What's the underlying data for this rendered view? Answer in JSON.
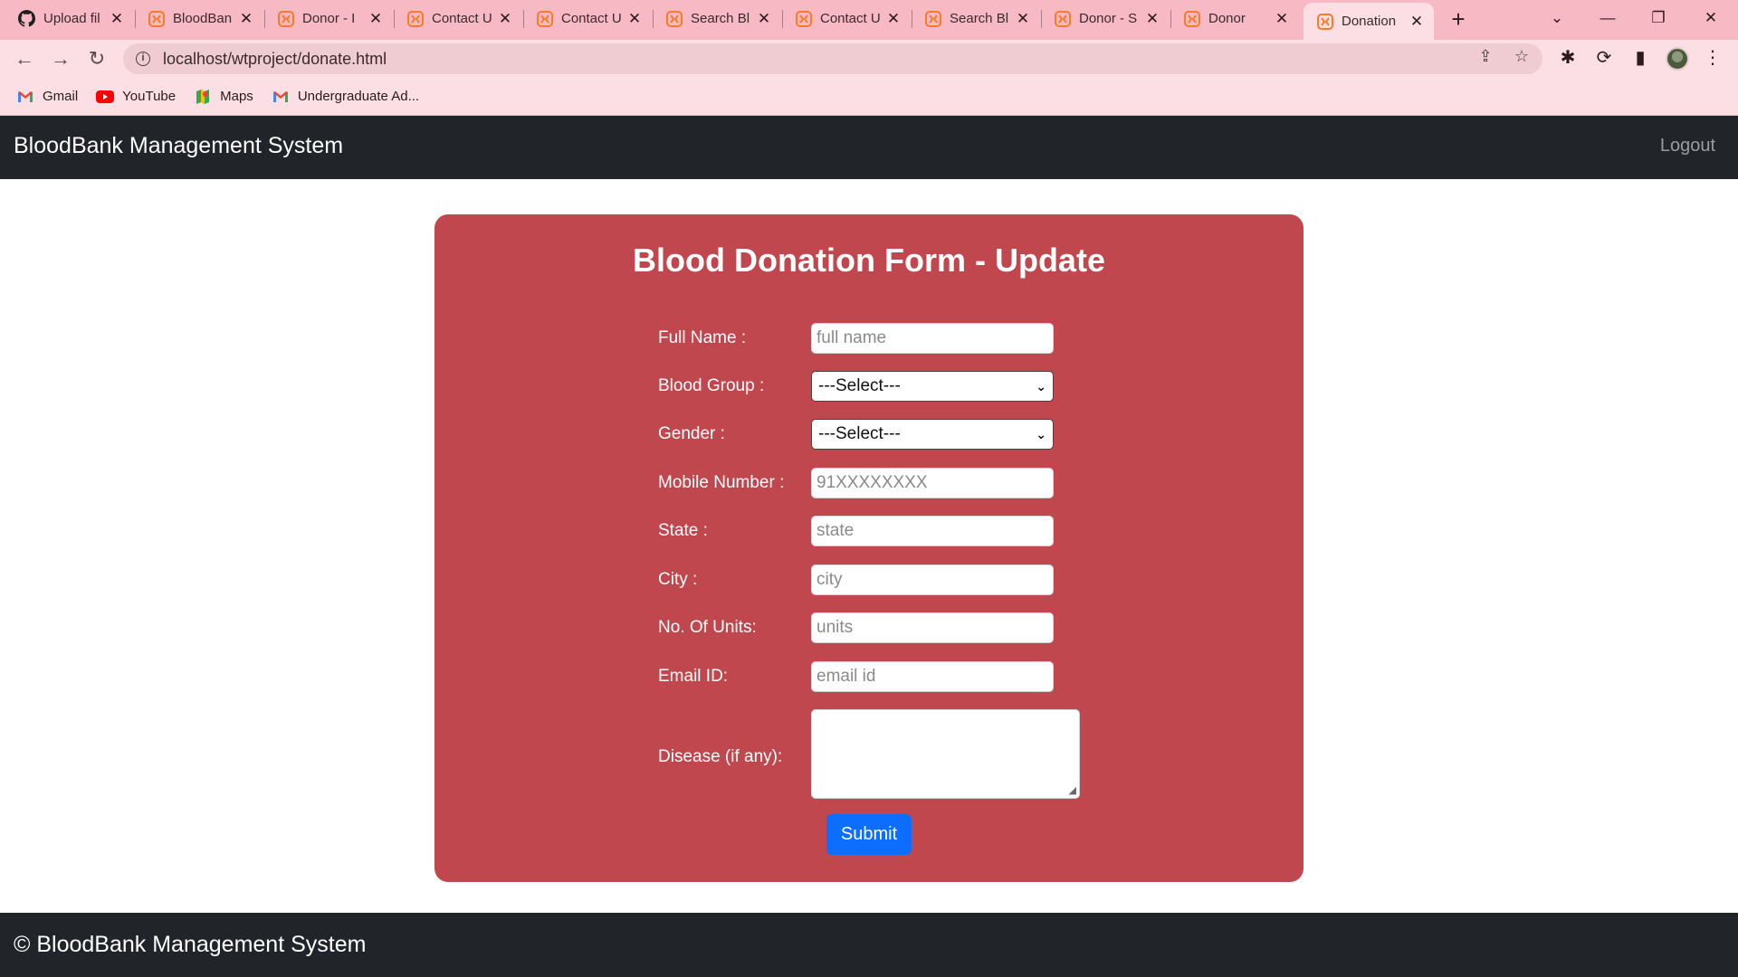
{
  "browser": {
    "tabs": [
      {
        "label": "Upload fil",
        "icon": "github-icon",
        "active": false
      },
      {
        "label": "BloodBan",
        "icon": "xampp-icon",
        "active": false
      },
      {
        "label": "Donor - I",
        "icon": "xampp-icon",
        "active": false
      },
      {
        "label": "Contact U",
        "icon": "xampp-icon",
        "active": false
      },
      {
        "label": "Contact U",
        "icon": "xampp-icon",
        "active": false
      },
      {
        "label": "Search Bl",
        "icon": "xampp-icon",
        "active": false
      },
      {
        "label": "Contact U",
        "icon": "xampp-icon",
        "active": false
      },
      {
        "label": "Search Bl",
        "icon": "xampp-icon",
        "active": false
      },
      {
        "label": "Donor - S",
        "icon": "xampp-icon",
        "active": false
      },
      {
        "label": "Donor",
        "icon": "xampp-icon",
        "active": false
      },
      {
        "label": "Donation",
        "icon": "xampp-icon",
        "active": true
      }
    ],
    "url": "localhost/wtproject/donate.html",
    "bookmarks": [
      {
        "label": "Gmail",
        "icon": "gmail-icon"
      },
      {
        "label": "YouTube",
        "icon": "youtube-icon"
      },
      {
        "label": "Maps",
        "icon": "maps-icon"
      },
      {
        "label": "Undergraduate Ad...",
        "icon": "gmail-icon"
      }
    ],
    "colors": {
      "tabbar": "#f7b9c3",
      "toolbar": "#fbdfe4"
    }
  },
  "navbar": {
    "brand": "BloodBank Management System",
    "logout": "Logout"
  },
  "form": {
    "title": "Blood Donation Form - Update",
    "fields": {
      "full_name": {
        "label": "Full Name :",
        "placeholder": "full name"
      },
      "blood_group": {
        "label": "Blood Group :",
        "selected": "---Select---"
      },
      "gender": {
        "label": "Gender :",
        "selected": "---Select---"
      },
      "mobile": {
        "label": "Mobile Number :",
        "placeholder": "91XXXXXXXX"
      },
      "state": {
        "label": "State :",
        "placeholder": "state"
      },
      "city": {
        "label": "City :",
        "placeholder": "city"
      },
      "units": {
        "label": "No. Of Units:",
        "placeholder": "units"
      },
      "email": {
        "label": "Email ID:",
        "placeholder": "email id"
      },
      "disease": {
        "label": "Disease (if any):"
      }
    },
    "submit": "Submit",
    "colors": {
      "card": "#c0474d",
      "button": "#0d6efd"
    }
  },
  "footer": {
    "text": "© BloodBank Management System"
  }
}
